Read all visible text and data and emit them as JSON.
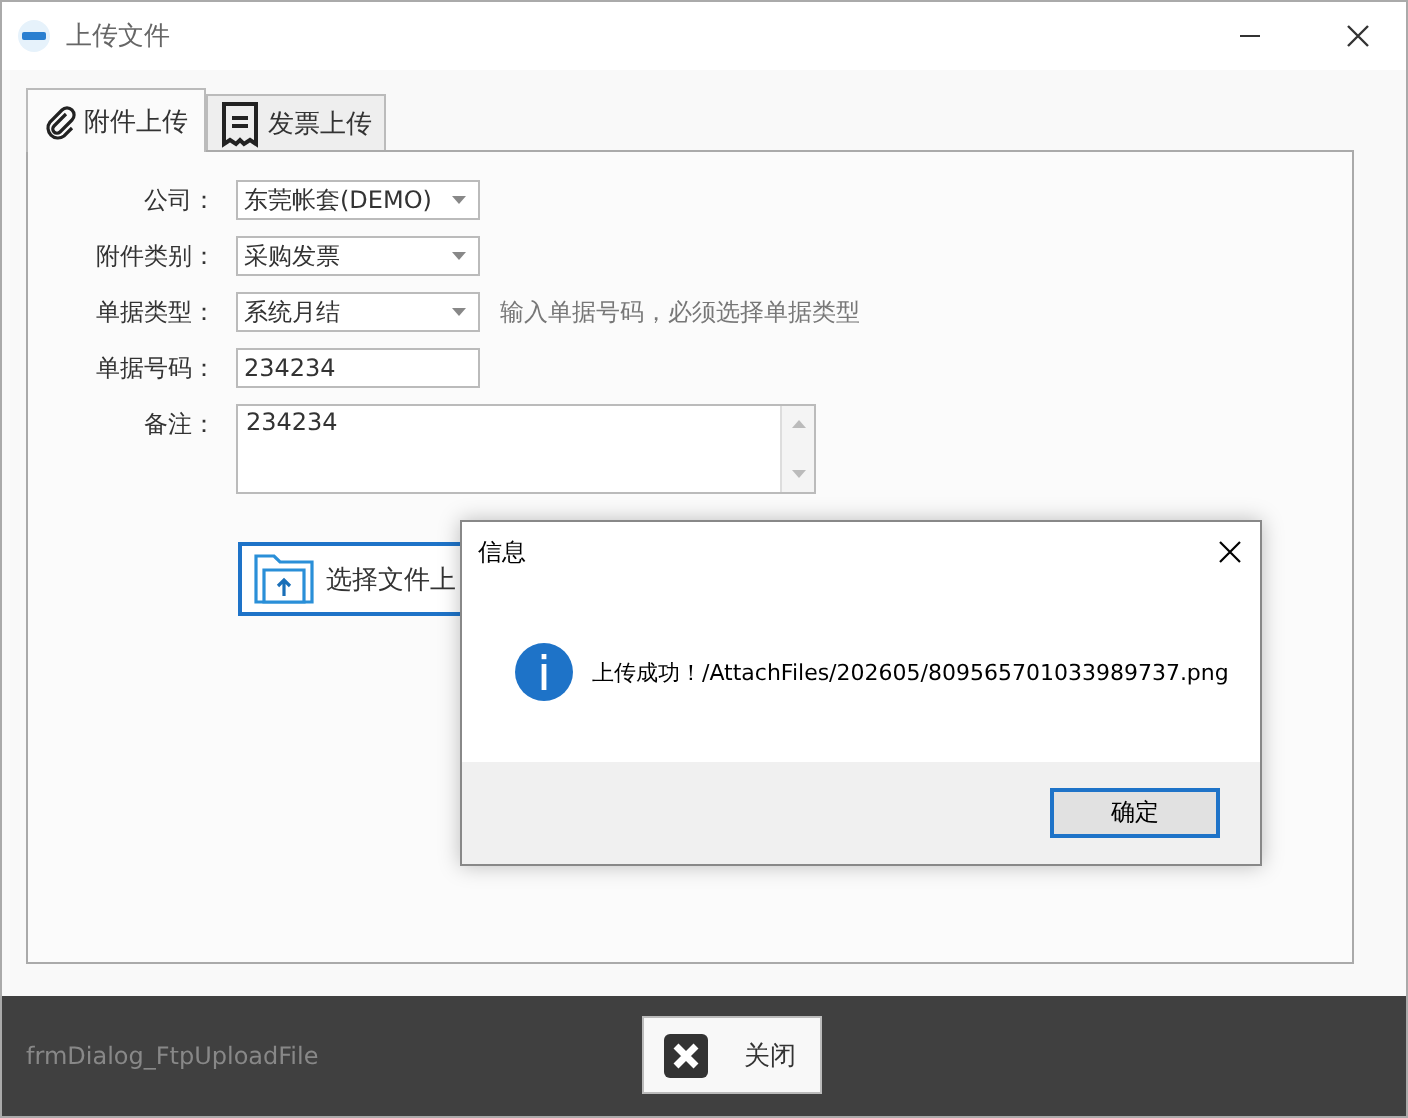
{
  "window": {
    "title": "上传文件"
  },
  "tabs": [
    {
      "label": "附件上传",
      "selected": true,
      "kind": "attachment"
    },
    {
      "label": "发票上传",
      "selected": false,
      "kind": "invoice"
    }
  ],
  "form": [
    {
      "label": "公司：",
      "kind": "combo",
      "value": "东莞帐套(DEMO)"
    },
    {
      "label": "附件类别：",
      "kind": "combo",
      "value": "采购发票"
    },
    {
      "label": "单据类型：",
      "kind": "combo",
      "value": "系统月结",
      "hint": "输入单据号码，必须选择单据类型"
    },
    {
      "label": "单据号码：",
      "kind": "text",
      "value": "234234"
    },
    {
      "label": "备注：",
      "kind": "memo",
      "value": "234234"
    }
  ],
  "upload_button": {
    "label": "选择文件上"
  },
  "footer": {
    "form_name": "frmDialog_FtpUploadFile",
    "close_button": "关闭"
  },
  "dialog": {
    "title": "信息",
    "message": "上传成功！/AttachFiles/202605/809565701033989737.png",
    "ok_button": "确定"
  }
}
